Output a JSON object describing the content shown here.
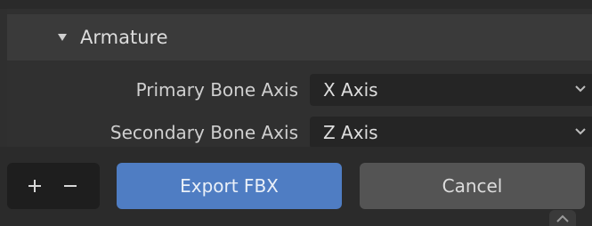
{
  "panel": {
    "header_label": "Armature",
    "rows": [
      {
        "label": "Primary Bone Axis",
        "value": "X Axis"
      },
      {
        "label": "Secondary Bone Axis",
        "value": "Z Axis"
      }
    ]
  },
  "footer": {
    "export_label": "Export FBX",
    "cancel_label": "Cancel"
  },
  "colors": {
    "accent": "#4f7dc3",
    "panel_bg": "#303030",
    "header_bg": "#3a3a3a",
    "field_bg": "#252525"
  },
  "icons": [
    "disclosure-triangle-icon",
    "chevron-down-icon",
    "plus-icon",
    "minus-icon",
    "chevron-up-icon"
  ]
}
